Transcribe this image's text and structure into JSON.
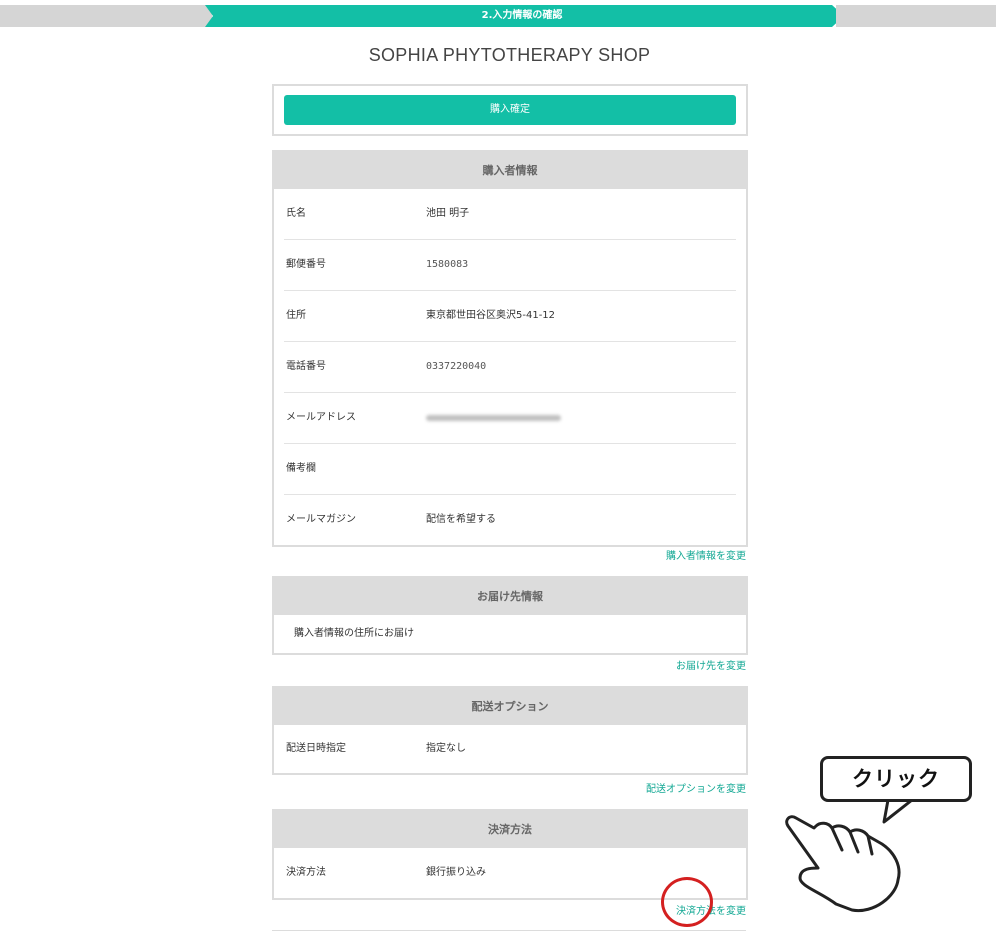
{
  "progress": {
    "step_label": "2.入力情報の確認",
    "accent": "#13bfa6"
  },
  "shop": {
    "title": "SOPHIA PHYTOTHERAPY SHOP"
  },
  "confirm": {
    "button_label": "購入確定"
  },
  "buyer": {
    "heading": "購入者情報",
    "rows": [
      {
        "label": "氏名",
        "value": "池田 明子"
      },
      {
        "label": "郵便番号",
        "value": "1580083"
      },
      {
        "label": "住所",
        "value": "東京都世田谷区奥沢5-41-12"
      },
      {
        "label": "電話番号",
        "value": "0337220040"
      },
      {
        "label": "メールアドレス",
        "value": ""
      },
      {
        "label": "備考欄",
        "value": ""
      },
      {
        "label": "メールマガジン",
        "value": "配信を希望する"
      }
    ],
    "change_link": "購入者情報を変更"
  },
  "delivery": {
    "heading": "お届け先情報",
    "value": "購入者情報の住所にお届け",
    "change_link": "お届け先を変更"
  },
  "shipping_option": {
    "heading": "配送オプション",
    "label": "配送日時指定",
    "value": "指定なし",
    "change_link": "配送オプションを変更"
  },
  "payment": {
    "heading": "決済方法",
    "label": "決済方法",
    "value": "銀行振り込み",
    "change_link": "決済方法を変更"
  },
  "callout": {
    "text": "クリック",
    "icon": "pointing-hand-icon"
  }
}
